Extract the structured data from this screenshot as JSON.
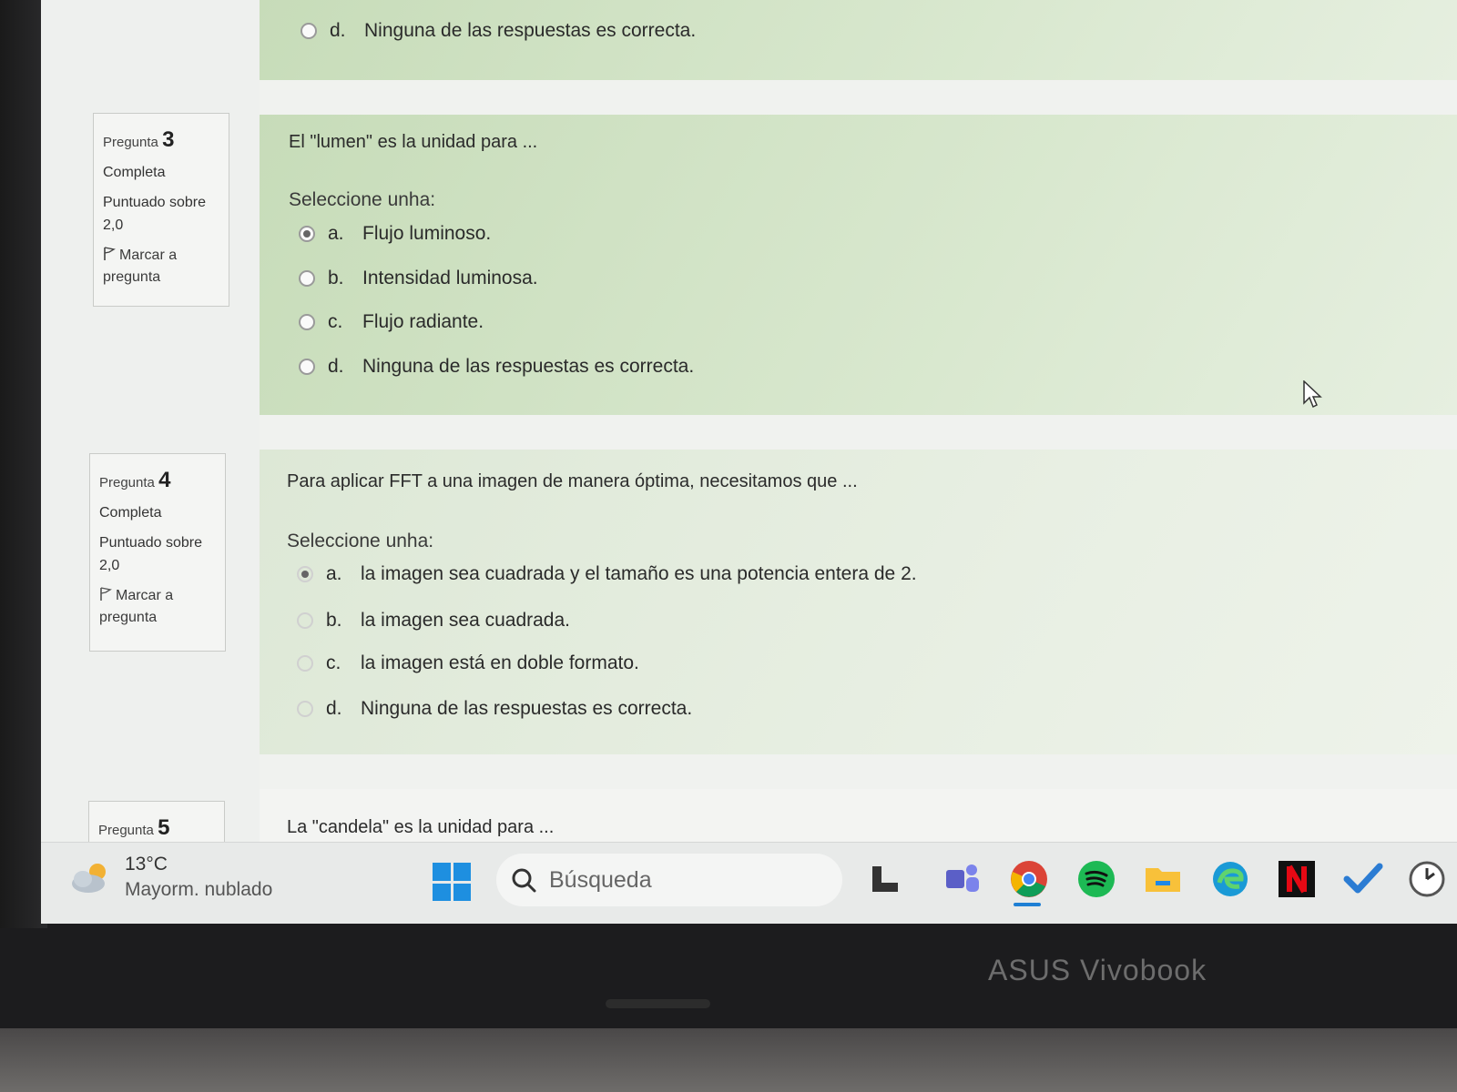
{
  "prev_question": {
    "option_d": {
      "letter": "d.",
      "text": "Ninguna de las respuestas es correcta."
    }
  },
  "questions": [
    {
      "label": "Pregunta",
      "number": "3",
      "state": "Completa",
      "grade_label": "Puntuado sobre",
      "grade_value": "2,0",
      "flag_label": "Marcar a pregunta",
      "text": "El \"lumen\" es la unidad para ...",
      "prompt": "Seleccione unha:",
      "options": [
        {
          "letter": "a.",
          "text": "Flujo luminoso.",
          "selected": true
        },
        {
          "letter": "b.",
          "text": "Intensidad luminosa.",
          "selected": false
        },
        {
          "letter": "c.",
          "text": "Flujo radiante.",
          "selected": false
        },
        {
          "letter": "d.",
          "text": "Ninguna de las respuestas es correcta.",
          "selected": false
        }
      ]
    },
    {
      "label": "Pregunta",
      "number": "4",
      "state": "Completa",
      "grade_label": "Puntuado sobre",
      "grade_value": "2,0",
      "flag_label": "Marcar a pregunta",
      "text": "Para aplicar FFT a una imagen de manera óptima, necesitamos que ...",
      "prompt": "Seleccione unha:",
      "options": [
        {
          "letter": "a.",
          "text": "la imagen sea cuadrada y el tamaño es una potencia entera de 2.",
          "selected": true
        },
        {
          "letter": "b.",
          "text": "la imagen sea cuadrada.",
          "selected": false
        },
        {
          "letter": "c.",
          "text": "la imagen está en doble formato.",
          "selected": false
        },
        {
          "letter": "d.",
          "text": "Ninguna de las respuestas es correcta.",
          "selected": false
        }
      ]
    },
    {
      "label": "Pregunta",
      "number": "5",
      "text": "La \"candela\" es la unidad para ..."
    }
  ],
  "taskbar": {
    "weather_temp": "13°C",
    "weather_cond": "Mayorm. nublado",
    "search_placeholder": "Búsqueda"
  },
  "laptop_brand": "ASUS Vivobook",
  "colors": {
    "panel_green": "#c7dcb9",
    "windows_blue": "#1e8fe0"
  }
}
